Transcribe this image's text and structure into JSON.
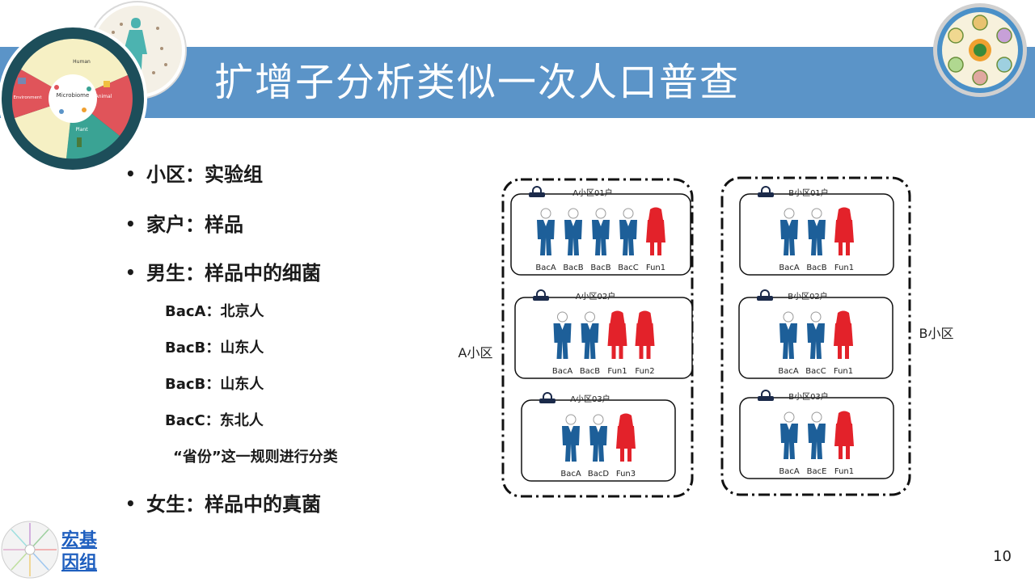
{
  "slide": {
    "title": "扩增子分析类似一次人口普查",
    "page_number": "10"
  },
  "logo_left_labels": {
    "human": "Human",
    "microbiome": "Microbiome",
    "animal": "Animal",
    "environment": "Environment",
    "plant": "Plant"
  },
  "bullets": [
    {
      "text": "小区：实验组"
    },
    {
      "text": "家户：样品"
    },
    {
      "text": "男生：样品中的细菌"
    },
    {
      "text": "女生：样品中的真菌"
    }
  ],
  "sub_items": [
    {
      "text": "BacA：北京人"
    },
    {
      "text": "BacB：山东人"
    },
    {
      "text": "BacB：山东人"
    },
    {
      "text": "BacC：东北人"
    },
    {
      "text": "“省份”这一规则进行分类"
    }
  ],
  "diagram": {
    "district_a_label": "A小区",
    "district_b_label": "B小区",
    "households": [
      {
        "title": "A小区01户",
        "members": [
          {
            "label": "BacA",
            "type": "male"
          },
          {
            "label": "BacB",
            "type": "male"
          },
          {
            "label": "BacB",
            "type": "male"
          },
          {
            "label": "BacC",
            "type": "male"
          },
          {
            "label": "Fun1",
            "type": "female"
          }
        ]
      },
      {
        "title": "A小区02户",
        "members": [
          {
            "label": "BacA",
            "type": "male"
          },
          {
            "label": "BacB",
            "type": "male"
          },
          {
            "label": "Fun1",
            "type": "female"
          },
          {
            "label": "Fun2",
            "type": "female"
          }
        ]
      },
      {
        "title": "A小区03户",
        "members": [
          {
            "label": "BacA",
            "type": "male"
          },
          {
            "label": "BacD",
            "type": "male"
          },
          {
            "label": "Fun3",
            "type": "female"
          }
        ]
      },
      {
        "title": "B小区01户",
        "members": [
          {
            "label": "BacA",
            "type": "male"
          },
          {
            "label": "BacB",
            "type": "male"
          },
          {
            "label": "Fun1",
            "type": "female"
          }
        ]
      },
      {
        "title": "B小区02户",
        "members": [
          {
            "label": "BacA",
            "type": "male"
          },
          {
            "label": "BacC",
            "type": "male"
          },
          {
            "label": "Fun1",
            "type": "female"
          }
        ]
      },
      {
        "title": "B小区03户",
        "members": [
          {
            "label": "BacA",
            "type": "male"
          },
          {
            "label": "BacE",
            "type": "male"
          },
          {
            "label": "Fun1",
            "type": "female"
          }
        ]
      }
    ]
  },
  "footer": {
    "link_line1": "宏基",
    "link_line2": "因组"
  },
  "colors": {
    "title_bar": "#5b94c8",
    "male": "#1d5f99",
    "female": "#e3222a",
    "link": "#1f5fbf"
  }
}
